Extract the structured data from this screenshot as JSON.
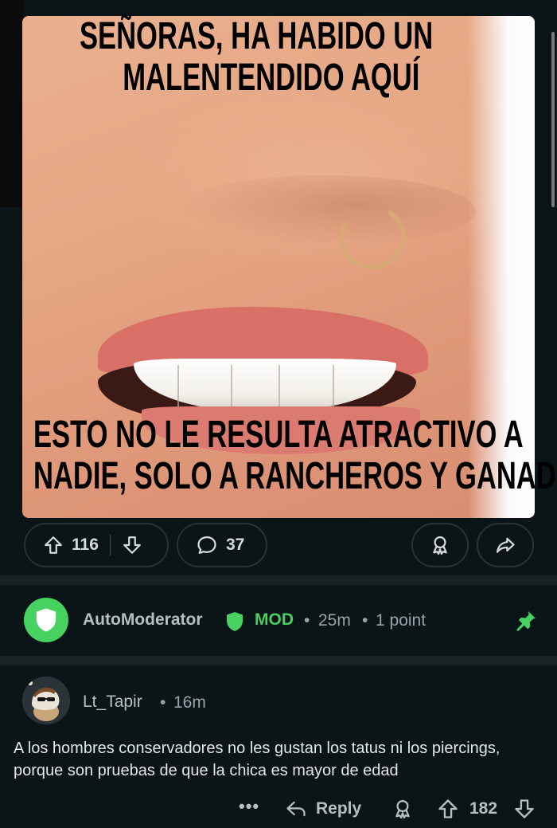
{
  "meme": {
    "top_line_1": "SEÑORAS, HA HABIDO UN",
    "top_line_2": "MALENTENDIDO AQUÍ",
    "bottom_line_1": "ESTO NO LE RESULTA ATRACTIVO A",
    "bottom_line_2": "NADIE, SOLO A RANCHEROS Y GANADO"
  },
  "post_actions": {
    "upvotes": "116",
    "comments": "37"
  },
  "automod": {
    "username": "AutoModerator",
    "tag": "MOD",
    "sep1": "•",
    "time": "25m",
    "sep2": "•",
    "points": "1 point"
  },
  "comment": {
    "username": "Lt_Tapir",
    "sep": "•",
    "time": "16m",
    "body_line_1": "A los hombres conservadores no les gustan los tatus ni los piercings,",
    "body_line_2": "porque son pruebas de que la chica es mayor de edad",
    "more": "•••",
    "reply_label": "Reply",
    "score": "182"
  },
  "colors": {
    "background": "#0b1416",
    "mod_green": "#46d160",
    "text_muted": "#9aa3a8"
  },
  "icons": [
    "upvote-icon",
    "downvote-icon",
    "comment-icon",
    "award-icon",
    "share-icon",
    "shield-icon",
    "pin-icon",
    "reply-icon"
  ]
}
